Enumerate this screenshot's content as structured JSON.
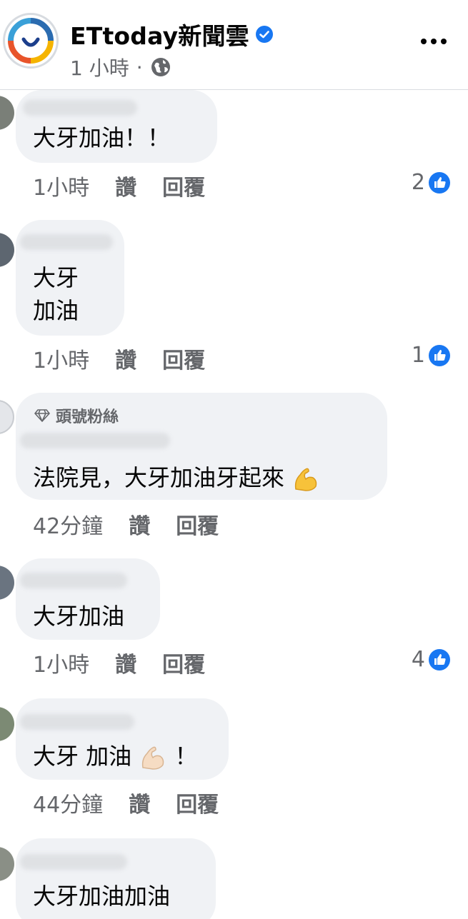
{
  "header": {
    "page_name": "ETtoday新聞雲",
    "time": "1 小時",
    "dot": "·"
  },
  "comments": [
    {
      "text": "大牙加油！！",
      "time": "1小時",
      "like": "讚",
      "reply": "回覆",
      "reactions": "2"
    },
    {
      "text_line1": "大牙",
      "text_line2": "加油",
      "time": "1小時",
      "like": "讚",
      "reply": "回覆",
      "reactions": "1"
    },
    {
      "badge": "頭號粉絲",
      "text": "法院見，大牙加油牙起來",
      "emoji": "flexed-biceps-yellow",
      "time": "42分鐘",
      "like": "讚",
      "reply": "回覆"
    },
    {
      "text": "大牙加油",
      "time": "1小時",
      "like": "讚",
      "reply": "回覆",
      "reactions": "4"
    },
    {
      "text_a": "大牙 加油",
      "emoji": "flexed-biceps-light",
      "text_b": "！",
      "time": "44分鐘",
      "like": "讚",
      "reply": "回覆"
    },
    {
      "text": "大牙加油加油"
    }
  ],
  "colors": {
    "bubble": "#f0f2f5",
    "secondary_text": "#65676b",
    "like_blue": "#1877f2",
    "brand_blue": "#1877f2"
  }
}
